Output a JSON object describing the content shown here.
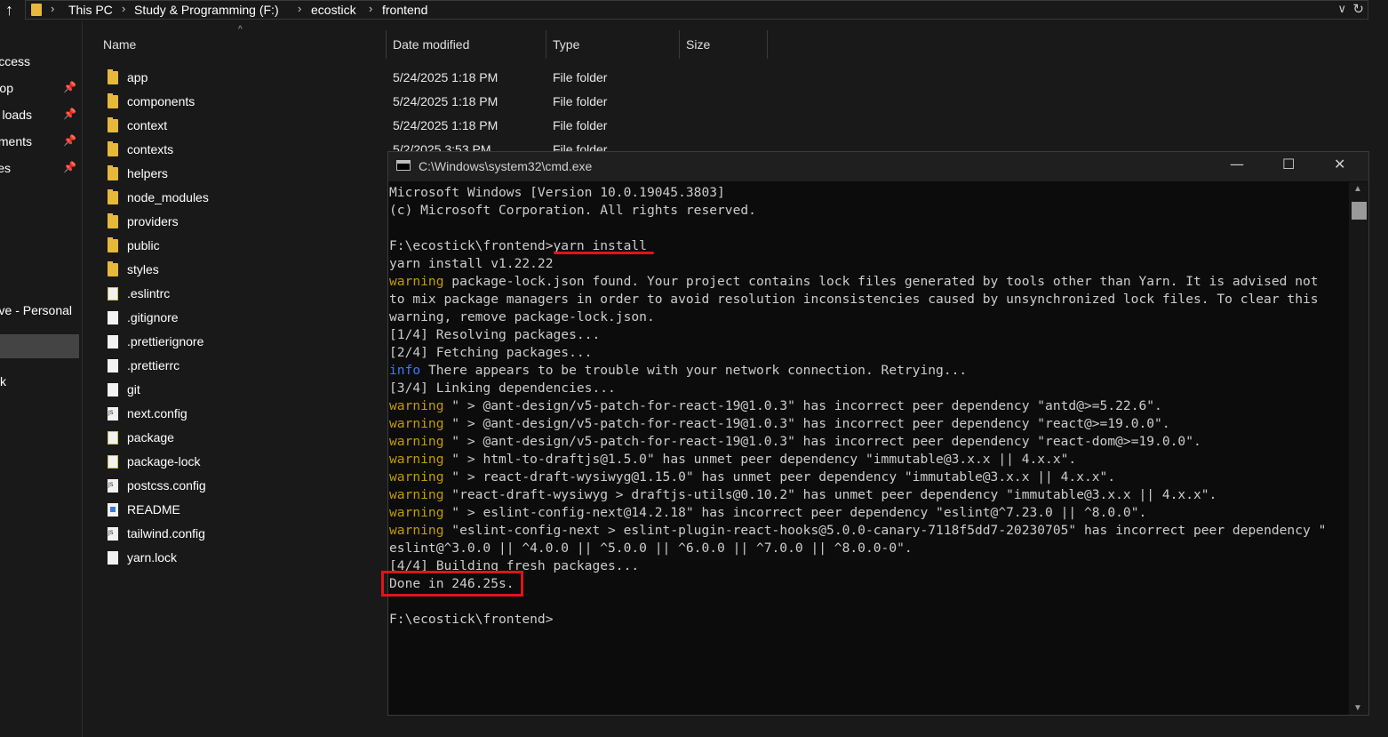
{
  "breadcrumb": [
    "This PC",
    "Study & Programming (F:)",
    "ecostick",
    "frontend"
  ],
  "nav": {
    "items": [
      {
        "label": "ccess",
        "pinned": false
      },
      {
        "label": "op",
        "pinned": true
      },
      {
        "label": "loads",
        "pinned": true
      },
      {
        "label": "ments",
        "pinned": true
      },
      {
        "label": "es",
        "pinned": true
      },
      {
        "label": "ve - Personal",
        "pinned": false
      },
      {
        "label": "k",
        "pinned": false
      }
    ]
  },
  "columns": {
    "name": "Name",
    "date": "Date modified",
    "type": "Type",
    "size": "Size"
  },
  "files": [
    {
      "name": "app",
      "date": "5/24/2025 1:18 PM",
      "type": "File folder",
      "icon": "folder"
    },
    {
      "name": "components",
      "date": "5/24/2025 1:18 PM",
      "type": "File folder",
      "icon": "folder"
    },
    {
      "name": "context",
      "date": "5/24/2025 1:18 PM",
      "type": "File folder",
      "icon": "folder"
    },
    {
      "name": "contexts",
      "date": "5/2/2025 3:53 PM",
      "type": "File folder",
      "icon": "folder"
    },
    {
      "name": "helpers",
      "date": "",
      "type": "",
      "icon": "folder"
    },
    {
      "name": "node_modules",
      "date": "",
      "type": "",
      "icon": "folder"
    },
    {
      "name": "providers",
      "date": "",
      "type": "",
      "icon": "folder"
    },
    {
      "name": "public",
      "date": "",
      "type": "",
      "icon": "folder"
    },
    {
      "name": "styles",
      "date": "",
      "type": "",
      "icon": "folder"
    },
    {
      "name": ".eslintrc",
      "date": "",
      "type": "",
      "icon": "json"
    },
    {
      "name": ".gitignore",
      "date": "",
      "type": "",
      "icon": "doc"
    },
    {
      "name": ".prettierignore",
      "date": "",
      "type": "",
      "icon": "doc"
    },
    {
      "name": ".prettierrc",
      "date": "",
      "type": "",
      "icon": "doc"
    },
    {
      "name": "git",
      "date": "",
      "type": "",
      "icon": "doc"
    },
    {
      "name": "next.config",
      "date": "",
      "type": "",
      "icon": "js"
    },
    {
      "name": "package",
      "date": "",
      "type": "",
      "icon": "json"
    },
    {
      "name": "package-lock",
      "date": "",
      "type": "",
      "icon": "json"
    },
    {
      "name": "postcss.config",
      "date": "",
      "type": "",
      "icon": "js"
    },
    {
      "name": "README",
      "date": "",
      "type": "",
      "icon": "md"
    },
    {
      "name": "tailwind.config",
      "date": "",
      "type": "",
      "icon": "js"
    },
    {
      "name": "yarn.lock",
      "date": "",
      "type": "",
      "icon": "doc"
    }
  ],
  "cmd": {
    "title": "C:\\Windows\\system32\\cmd.exe",
    "lines": [
      {
        "prefix": "",
        "text": "Microsoft Windows [Version 10.0.19045.3803]"
      },
      {
        "prefix": "",
        "text": "(c) Microsoft Corporation. All rights reserved."
      },
      {
        "prefix": "",
        "text": ""
      },
      {
        "prefix": "",
        "text": "F:\\ecostick\\frontend>yarn install"
      },
      {
        "prefix": "",
        "text": "yarn install v1.22.22"
      },
      {
        "prefix": "warning",
        "text": " package-lock.json found. Your project contains lock files generated by tools other than Yarn. It is advised not"
      },
      {
        "prefix": "",
        "text": "to mix package managers in order to avoid resolution inconsistencies caused by unsynchronized lock files. To clear this"
      },
      {
        "prefix": "",
        "text": "warning, remove package-lock.json."
      },
      {
        "prefix": "",
        "text": "[1/4] Resolving packages..."
      },
      {
        "prefix": "",
        "text": "[2/4] Fetching packages..."
      },
      {
        "prefix": "info",
        "text": " There appears to be trouble with your network connection. Retrying..."
      },
      {
        "prefix": "",
        "text": "[3/4] Linking dependencies..."
      },
      {
        "prefix": "warning",
        "text": " \" > @ant-design/v5-patch-for-react-19@1.0.3\" has incorrect peer dependency \"antd@>=5.22.6\"."
      },
      {
        "prefix": "warning",
        "text": " \" > @ant-design/v5-patch-for-react-19@1.0.3\" has incorrect peer dependency \"react@>=19.0.0\"."
      },
      {
        "prefix": "warning",
        "text": " \" > @ant-design/v5-patch-for-react-19@1.0.3\" has incorrect peer dependency \"react-dom@>=19.0.0\"."
      },
      {
        "prefix": "warning",
        "text": " \" > html-to-draftjs@1.5.0\" has unmet peer dependency \"immutable@3.x.x || 4.x.x\"."
      },
      {
        "prefix": "warning",
        "text": " \" > react-draft-wysiwyg@1.15.0\" has unmet peer dependency \"immutable@3.x.x || 4.x.x\"."
      },
      {
        "prefix": "warning",
        "text": " \"react-draft-wysiwyg > draftjs-utils@0.10.2\" has unmet peer dependency \"immutable@3.x.x || 4.x.x\"."
      },
      {
        "prefix": "warning",
        "text": " \" > eslint-config-next@14.2.18\" has incorrect peer dependency \"eslint@^7.23.0 || ^8.0.0\"."
      },
      {
        "prefix": "warning",
        "text": " \"eslint-config-next > eslint-plugin-react-hooks@5.0.0-canary-7118f5dd7-20230705\" has incorrect peer dependency \""
      },
      {
        "prefix": "",
        "text": "eslint@^3.0.0 || ^4.0.0 || ^5.0.0 || ^6.0.0 || ^7.0.0 || ^8.0.0-0\"."
      },
      {
        "prefix": "",
        "text": "[4/4] Building fresh packages..."
      },
      {
        "prefix": "",
        "text": "Done in 246.25s."
      },
      {
        "prefix": "",
        "text": ""
      },
      {
        "prefix": "",
        "text": "F:\\ecostick\\frontend>"
      }
    ]
  },
  "colors": {
    "warning": "#c19c00",
    "info": "#3b78ff",
    "highlight": "#e0141b",
    "folder": "#e8b83a"
  }
}
